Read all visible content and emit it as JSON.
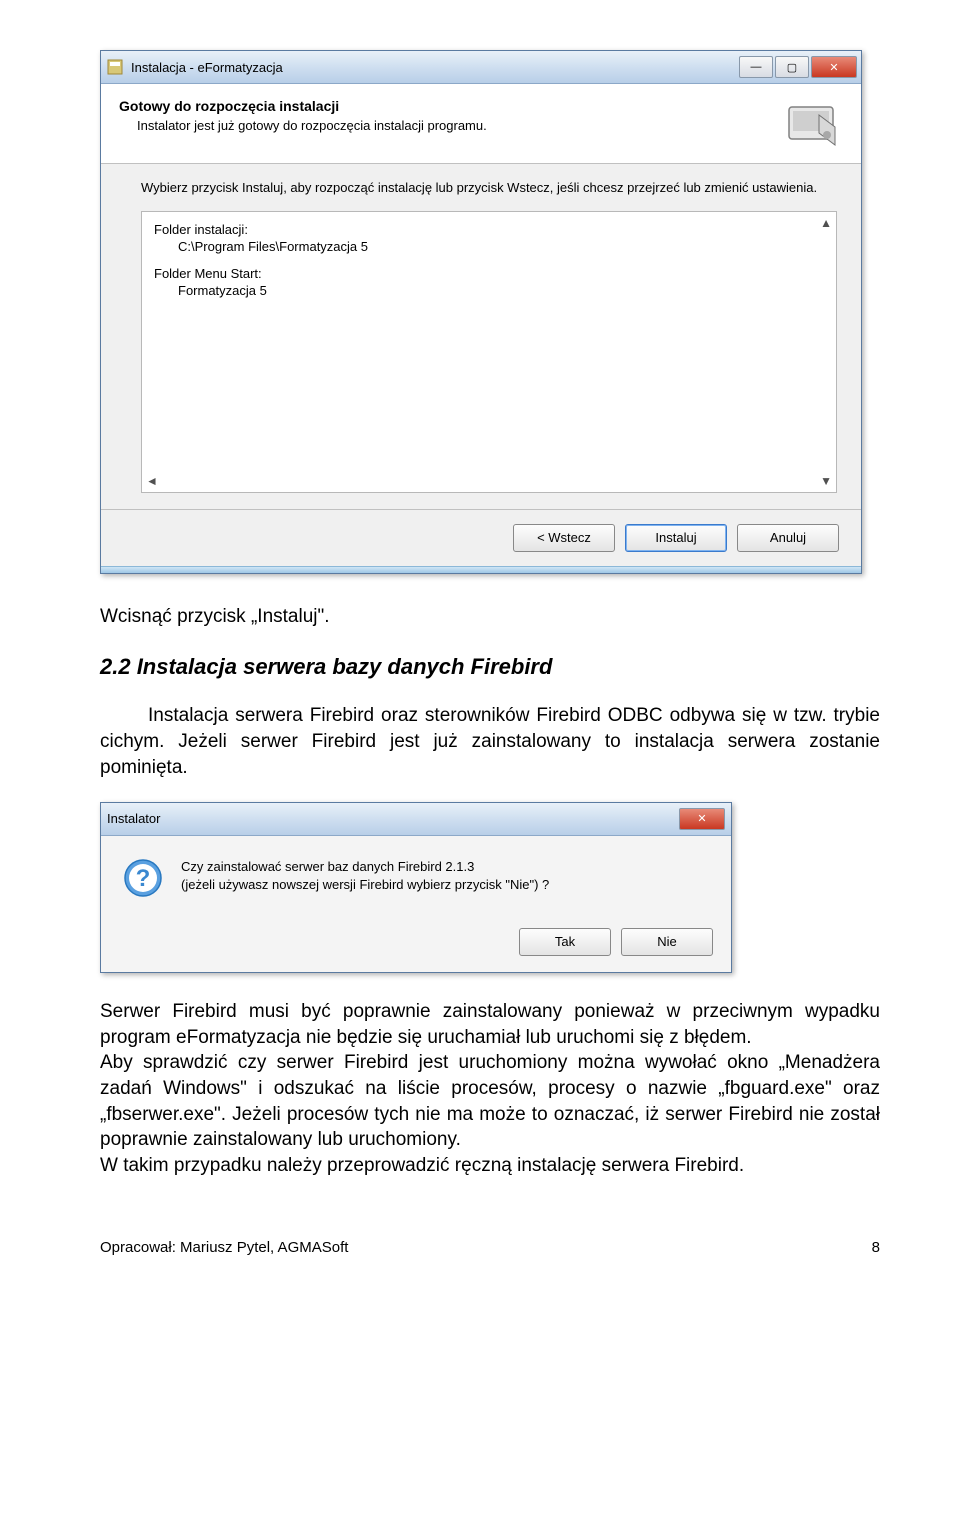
{
  "installer": {
    "title": "Instalacja - eFormatyzacja",
    "header_title": "Gotowy do rozpoczęcia instalacji",
    "header_sub": "Instalator jest już gotowy do rozpoczęcia instalacji programu.",
    "instruction": "Wybierz przycisk Instaluj, aby rozpocząć instalację lub przycisk Wstecz, jeśli chcesz przejrzeć lub zmienić ustawienia.",
    "folder_label": "Folder instalacji:",
    "folder_value": "C:\\Program Files\\Formatyzacja 5",
    "startmenu_label": "Folder Menu Start:",
    "startmenu_value": "Formatyzacja 5",
    "btn_back": "<  Wstecz",
    "btn_install": "Instaluj",
    "btn_cancel": "Anuluj"
  },
  "doc": {
    "p1": "Wcisnąć przycisk „Instaluj\".",
    "h2": "2.2  Instalacja serwera bazy danych Firebird",
    "p2": "Instalacja serwera Firebird oraz sterowników Firebird ODBC odbywa się w tzw. trybie cichym. Jeżeli serwer Firebird jest już zainstalowany to instalacja serwera zostanie pominięta.",
    "p3a": "Serwer Firebird musi być poprawnie zainstalowany ponieważ w przeciwnym wypadku program eFormatyzacja nie będzie się uruchamiał lub uruchomi się z błędem.",
    "p3b": "Aby sprawdzić czy serwer Firebird jest uruchomiony można wywołać okno „Menadżera zadań Windows\" i odszukać na liście procesów, procesy o nazwie „fbguard.exe\" oraz „fbserwer.exe\". Jeżeli procesów tych nie ma może to oznaczać, iż serwer Firebird nie został poprawnie zainstalowany lub uruchomiony.",
    "p3c": "W takim przypadku należy przeprowadzić ręczną instalację serwera Firebird."
  },
  "dialog": {
    "title": "Instalator",
    "line1": "Czy zainstalować serwer baz danych Firebird 2.1.3",
    "line2": "(jeżeli używasz nowszej wersji Firebird wybierz przycisk \"Nie\") ?",
    "btn_yes": "Tak",
    "btn_no": "Nie"
  },
  "footer": {
    "left": "Opracował: Mariusz Pytel, AGMASoft",
    "right": "8"
  }
}
